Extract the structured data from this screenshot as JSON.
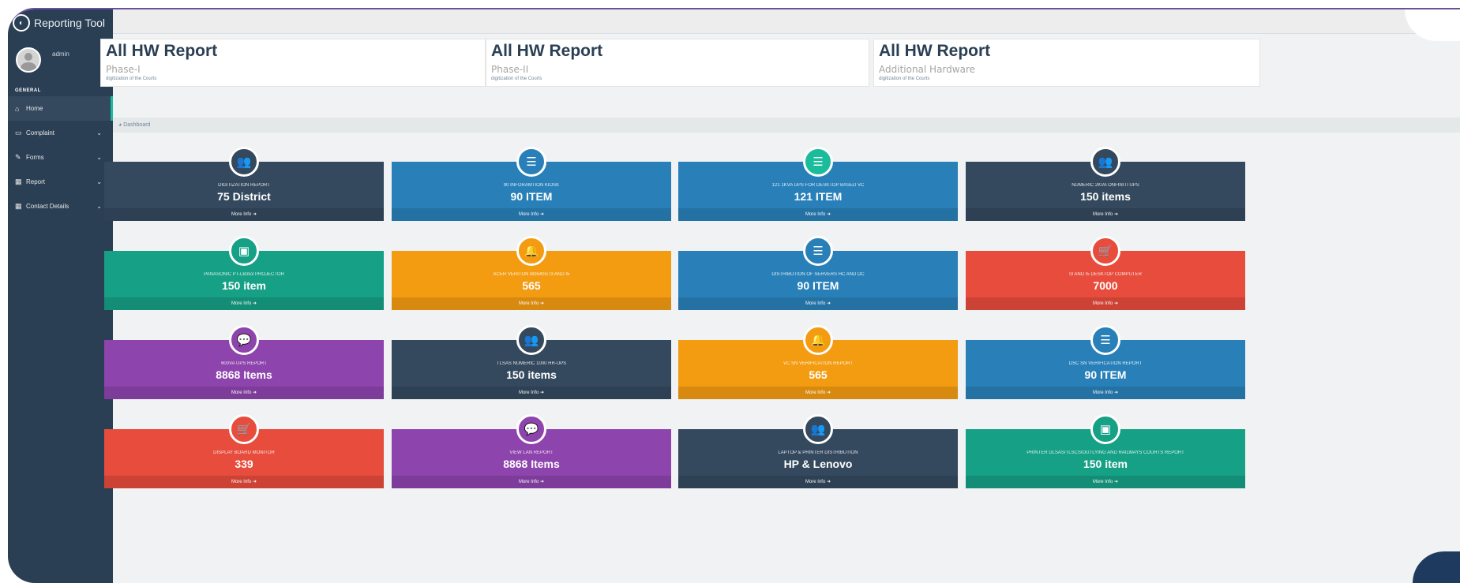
{
  "app": {
    "title": "Reporting Tool"
  },
  "sidebar": {
    "username": "admin",
    "section": "GENERAL",
    "items": [
      {
        "label": "Home",
        "icon": "home-icon",
        "active": true
      },
      {
        "label": "Complaint",
        "icon": "desktop-icon"
      },
      {
        "label": "Forms",
        "icon": "edit-icon"
      },
      {
        "label": "Report",
        "icon": "table-icon"
      },
      {
        "label": "Contact Details",
        "icon": "table-icon"
      }
    ]
  },
  "topbar": {
    "user": "adm"
  },
  "headers": [
    {
      "title": "All HW Report",
      "subtitle": "Phase-I",
      "note": "digitization of the Courts"
    },
    {
      "title": "All HW Report",
      "subtitle": "Phase-II",
      "note": "digitization of the Courts"
    },
    {
      "title": "All HW Report",
      "subtitle": "Additional Hardware",
      "note": "digitization of the Courts"
    }
  ],
  "breadcrumb": "Dashboard",
  "tiles": [
    {
      "caption": "DIGITIZATION REPORT",
      "value": "75 District",
      "more": "More Info",
      "color": "#34495e",
      "icon": "users-icon"
    },
    {
      "caption": "90 INFORAMTION KIOSK",
      "value": "90 ITEM",
      "more": "More Info",
      "color": "#2980b9",
      "icon": "server-icon"
    },
    {
      "caption": "121 1KVA UPS FOR DESKTOP BASED VC",
      "value": "121 ITEM",
      "more": "More Info",
      "color": "#2980b9",
      "icon": "server-icon",
      "circle": "#1abc9c"
    },
    {
      "caption": "NUMERIC 2KVA ONFINITI UPS",
      "value": "150 items",
      "more": "More Info",
      "color": "#34495e",
      "icon": "users-icon"
    },
    {
      "caption": "PANASONIC PT-LB353 PROJECTOR",
      "value": "150 item",
      "more": "More Info",
      "color": "#16a085",
      "icon": "money-icon"
    },
    {
      "caption": "ACER VERITON M2640G I3 AND I5",
      "value": "565",
      "more": "More Info",
      "color": "#f39c12",
      "icon": "bell-icon"
    },
    {
      "caption": "DISTRIBUTION OF SERVERS HC AND DC",
      "value": "90 ITEM",
      "more": "More Info",
      "color": "#2980b9",
      "icon": "server-icon"
    },
    {
      "caption": "I3 AND I5 DESKTOP COMPUTER",
      "value": "7000",
      "more": "More Info",
      "color": "#e74c3c",
      "icon": "cart-icon"
    },
    {
      "caption": "600VA UPS REPORT",
      "value": "8868 Items",
      "more": "More Info",
      "color": "#8e44ad",
      "icon": "comments-icon"
    },
    {
      "caption": "TLSAS NUMERIC 1000 HR-UPS",
      "value": "150 items",
      "more": "More Info",
      "color": "#34495e",
      "icon": "users-icon"
    },
    {
      "caption": "VC SN VERIFICATION REPORT",
      "value": "565",
      "more": "More Info",
      "color": "#f39c12",
      "icon": "bell-icon"
    },
    {
      "caption": "DSC SN VERIFICATION REPORT",
      "value": "90 ITEM",
      "more": "More Info",
      "color": "#2980b9",
      "icon": "server-icon"
    },
    {
      "caption": "DISPLAY BOARD MONITOR",
      "value": "339",
      "more": "More Info",
      "color": "#e74c3c",
      "icon": "cart-icon"
    },
    {
      "caption": "VIEW LAN REPORT",
      "value": "8868 Items",
      "more": "More Info",
      "color": "#8e44ad",
      "icon": "comments-icon"
    },
    {
      "caption": "LAPTOP & PRINTER DISTRIBUTION",
      "value": "HP & Lenovo",
      "more": "More Info",
      "color": "#34495e",
      "icon": "users-icon"
    },
    {
      "caption": "PRINTER DLSAS/TLSCS/OUTLYING AND RAILWAYS COURTS REPORT",
      "value": "150 item",
      "more": "More Info",
      "color": "#16a085",
      "icon": "money-icon"
    }
  ]
}
